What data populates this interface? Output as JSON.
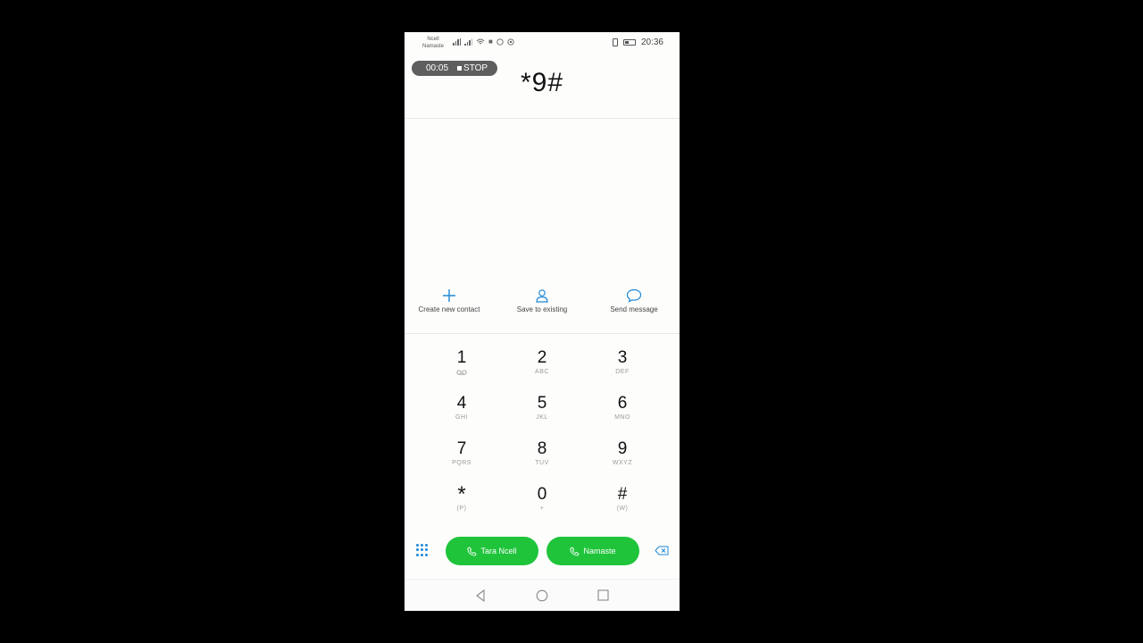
{
  "status_bar": {
    "carrier_line1": "Ncell",
    "carrier_line2": "Namaste",
    "time": "20:36"
  },
  "recorder": {
    "elapsed": "00:05",
    "stop_label": "STOP"
  },
  "dialer": {
    "number": "*9#"
  },
  "actions": [
    {
      "label": "Create new contact",
      "icon": "plus-icon"
    },
    {
      "label": "Save to existing",
      "icon": "person-icon"
    },
    {
      "label": "Send message",
      "icon": "chat-bubble-icon"
    }
  ],
  "keypad": [
    {
      "digit": "1",
      "letters": ""
    },
    {
      "digit": "2",
      "letters": "ABC"
    },
    {
      "digit": "3",
      "letters": "DEF"
    },
    {
      "digit": "4",
      "letters": "GHI"
    },
    {
      "digit": "5",
      "letters": "JKL"
    },
    {
      "digit": "6",
      "letters": "MNO"
    },
    {
      "digit": "7",
      "letters": "PQRS"
    },
    {
      "digit": "8",
      "letters": "TUV"
    },
    {
      "digit": "9",
      "letters": "WXYZ"
    },
    {
      "digit": "*",
      "letters": "(P)"
    },
    {
      "digit": "0",
      "letters": "+"
    },
    {
      "digit": "#",
      "letters": "(W)"
    }
  ],
  "call_buttons": [
    {
      "label": "Tara Ncell"
    },
    {
      "label": "Namaste"
    }
  ],
  "colors": {
    "accent_blue": "#1f87d6",
    "call_green": "#1fc43b"
  }
}
